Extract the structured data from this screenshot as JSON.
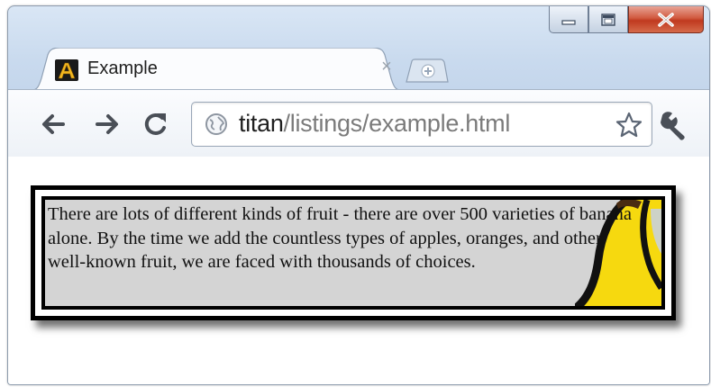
{
  "window": {
    "caption_buttons": [
      "minimize",
      "maximize",
      "close"
    ],
    "close_color": "#c0391f"
  },
  "tab": {
    "title": "Example",
    "favicon_letter": "A",
    "close_glyph": "×"
  },
  "toolbar": {
    "back_icon": "back-arrow-icon",
    "forward_icon": "forward-arrow-icon",
    "reload_icon": "reload-icon",
    "url_host": "titan",
    "url_path": "/listings/example.html",
    "bookmark_icon": "star-icon",
    "menu_icon": "wrench-icon"
  },
  "content": {
    "paragraph": "There are lots of different kinds of fruit - there are over 500 varieties of banana alone. By the time we add the countless types of apples, oranges, and other well-known fruit, we are faced with thousands of choices.",
    "background_color": "#d4d4d4",
    "banana_color": "#f6d90f"
  }
}
